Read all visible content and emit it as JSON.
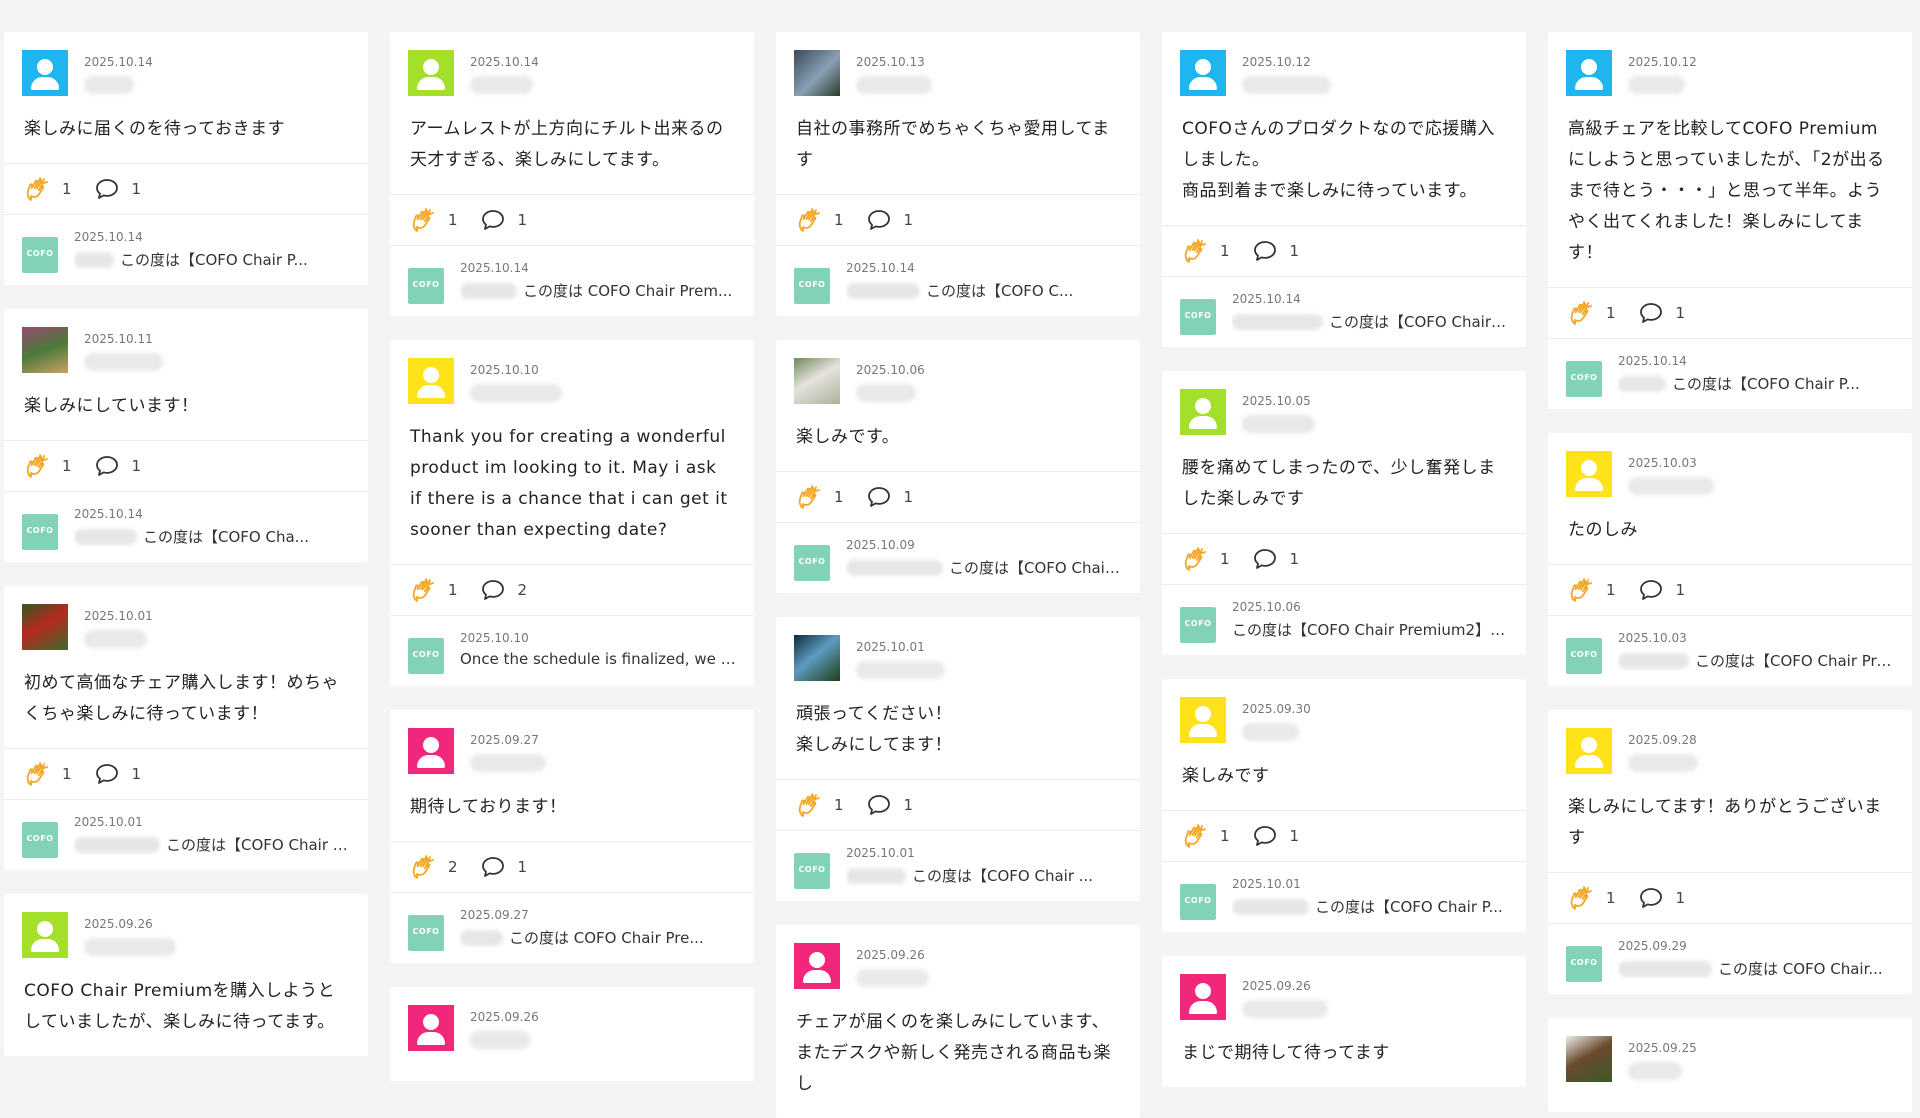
{
  "colors": {
    "cyan": "#1fb6ef",
    "lime": "#a4e02a",
    "yellow": "#ffe21a",
    "pink": "#f0277a",
    "cofo": "#82d3b5",
    "clap": "#f5a623"
  },
  "columns": [
    {
      "cards": [
        {
          "avatar": "cyan",
          "date": "2025.10.14",
          "comment": "楽しみに届くのを待っておきます",
          "claps": "1",
          "comments": "1",
          "reply": {
            "date": "2025.10.14",
            "text": "この度は【COFO Chair P..."
          }
        },
        {
          "avatar": "photo-garden",
          "date": "2025.10.11",
          "comment": "楽しみにしています！",
          "claps": "1",
          "comments": "1",
          "reply": {
            "date": "2025.10.14",
            "text": "この度は【COFO Cha..."
          }
        },
        {
          "avatar": "photo-tomato",
          "date": "2025.10.01",
          "comment": "初めて高価なチェア購入します！めちゃくちゃ楽しみに待っています！",
          "claps": "1",
          "comments": "1",
          "reply": {
            "date": "2025.10.01",
            "text": "この度は【COFO Chair Prem..."
          }
        },
        {
          "avatar": "lime",
          "date": "2025.09.26",
          "comment": "COFO Chair Premiumを購入しようとしていましたが、楽しみに待ってます。",
          "claps": "",
          "comments": "",
          "reply": null
        }
      ]
    },
    {
      "cards": [
        {
          "avatar": "lime",
          "date": "2025.10.14",
          "comment": "アームレストが上方向にチルト出来るの天才すぎる、楽しみにしてます。",
          "claps": "1",
          "comments": "1",
          "reply": {
            "date": "2025.10.14",
            "text": "この度は COFO Chair Prem..."
          }
        },
        {
          "avatar": "yellow",
          "date": "2025.10.10",
          "comment": "Thank you for creating a wonderful product im looking to it. May i ask if there is a chance that i can get it sooner than expecting date?",
          "claps": "1",
          "comments": "2",
          "reply": {
            "date": "2025.10.10",
            "text": "Once the schedule is finalized, we will..."
          }
        },
        {
          "avatar": "pink",
          "date": "2025.09.27",
          "comment": "期待しております！",
          "claps": "2",
          "comments": "1",
          "reply": {
            "date": "2025.09.27",
            "text": "この度は COFO Chair Pre..."
          }
        },
        {
          "avatar": "pink",
          "date": "2025.09.26",
          "comment": "",
          "claps": "",
          "comments": "",
          "reply": null
        }
      ]
    },
    {
      "cards": [
        {
          "avatar": "photo-office",
          "date": "2025.10.13",
          "comment": "自社の事務所でめちゃくちゃ愛用してます",
          "claps": "1",
          "comments": "1",
          "reply": {
            "date": "2025.10.14",
            "text": "この度は【COFO C..."
          }
        },
        {
          "avatar": "photo-cat",
          "date": "2025.10.06",
          "comment": "楽しみです。",
          "claps": "1",
          "comments": "1",
          "reply": {
            "date": "2025.10.09",
            "text": "この度は【COFO Chair ..."
          }
        },
        {
          "avatar": "photo-leaf",
          "date": "2025.10.01",
          "comment": "頑張ってください！\n楽しみにしてます！",
          "claps": "1",
          "comments": "1",
          "reply": {
            "date": "2025.10.01",
            "text": "この度は【COFO Chair ..."
          }
        },
        {
          "avatar": "pink",
          "date": "2025.09.26",
          "comment": "チェアが届くのを楽しみにしています、またデスクや新しく発売される商品も楽し",
          "claps": "",
          "comments": "",
          "reply": null
        }
      ]
    },
    {
      "cards": [
        {
          "avatar": "cyan",
          "date": "2025.10.12",
          "comment": "COFOさんのプロダクトなので応援購入しました。\n商品到着まで楽しみに待っています。",
          "claps": "1",
          "comments": "1",
          "reply": {
            "date": "2025.10.14",
            "text": "この度は【COFO Chair Prem..."
          }
        },
        {
          "avatar": "lime",
          "date": "2025.10.05",
          "comment": "腰を痛めてしまったので、少し奮発しました楽しみです",
          "claps": "1",
          "comments": "1",
          "reply": {
            "date": "2025.10.06",
            "text": "この度は【COFO Chair Premium2】を..."
          }
        },
        {
          "avatar": "yellow",
          "date": "2025.09.30",
          "comment": "楽しみです",
          "claps": "1",
          "comments": "1",
          "reply": {
            "date": "2025.10.01",
            "text": "この度は【COFO Chair P..."
          }
        },
        {
          "avatar": "pink",
          "date": "2025.09.26",
          "comment": "まじで期待して待ってます",
          "claps": "",
          "comments": "",
          "reply": null
        }
      ]
    },
    {
      "cards": [
        {
          "avatar": "cyan",
          "date": "2025.10.12",
          "comment": "高級チェアを比較してCOFO Premiumにしようと思っていましたが、「2が出るまで待とう・・・」と思って半年。ようやく出てくれました！楽しみにしてます！",
          "claps": "1",
          "comments": "1",
          "reply": {
            "date": "2025.10.14",
            "text": "この度は【COFO Chair P..."
          }
        },
        {
          "avatar": "yellow",
          "date": "2025.10.03",
          "comment": "たのしみ",
          "claps": "1",
          "comments": "1",
          "reply": {
            "date": "2025.10.03",
            "text": "この度は【COFO Chair Pre..."
          }
        },
        {
          "avatar": "yellow",
          "date": "2025.09.28",
          "comment": "楽しみにしてます！ありがとうございます",
          "claps": "1",
          "comments": "1",
          "reply": {
            "date": "2025.09.29",
            "text": "この度は COFO Chair..."
          }
        },
        {
          "avatar": "photo-horse",
          "date": "2025.09.25",
          "comment": "",
          "claps": "",
          "comments": "",
          "reply": null
        }
      ]
    }
  ],
  "labels": {
    "cofo_logo": "COFO"
  }
}
